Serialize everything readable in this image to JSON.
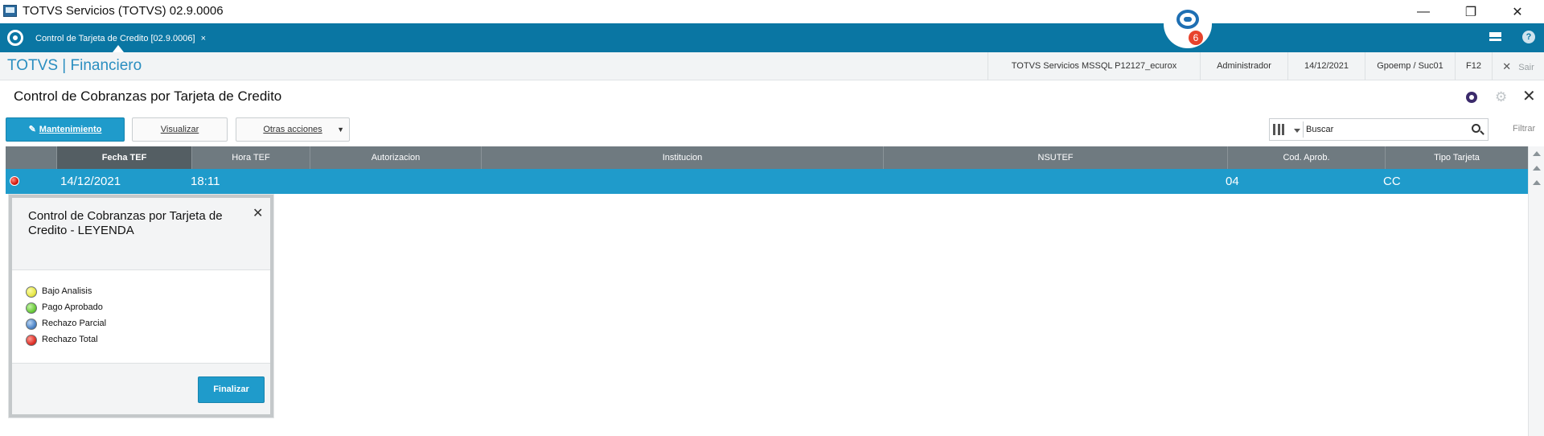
{
  "window": {
    "title": "TOTVS Servicios (TOTVS) 02.9.0006",
    "minimize": "—",
    "restore": "❐",
    "close": "✕"
  },
  "chat": {
    "badge": "6"
  },
  "tabs": [
    {
      "label": "Control de Tarjeta de Credito [02.9.0006]",
      "close": "×"
    }
  ],
  "module": {
    "brand": "TOTVS | Financiero",
    "environment": "TOTVS Servicios MSSQL P12127_ecurox",
    "user": "Administrador",
    "date": "14/12/2021",
    "branch": "Gpoemp / Suc01",
    "shortcut": "F12",
    "exit_icon": "✕",
    "exit": "Sair"
  },
  "page": {
    "title": "Control de Cobranzas por Tarjeta de Credito",
    "close": "✕"
  },
  "toolbar": {
    "mantenimiento": "Mantenimiento",
    "mantenimiento_icon": "✎",
    "visualizar": "Visualizar",
    "otras_acciones": "Otras acciones",
    "otras_caret": "▼",
    "search_placeholder": "Buscar",
    "filtrar": "Filtrar"
  },
  "grid": {
    "columns": [
      "Fecha TEF",
      "Hora TEF",
      "Autorizacion",
      "Institucion",
      "NSUTEF",
      "Cod. Aprob.",
      "Tipo Tarjeta"
    ],
    "rows": [
      {
        "status": "Rechazo Total",
        "fecha": "14/12/2021",
        "hora": "18:11",
        "autorizacion": "",
        "institucion": "",
        "nsutef": "",
        "cod_aprob": "04",
        "tipo": "CC"
      }
    ]
  },
  "legend": {
    "title": "Control de Cobranzas por Tarjeta de Credito - LEYENDA",
    "close": "✕",
    "items": [
      {
        "label": "Bajo Analisis",
        "color": "#e8e84a"
      },
      {
        "label": "Pago Aprobado",
        "color": "#6ccd3c"
      },
      {
        "label": "Rechazo Parcial",
        "color": "#4f86c8"
      },
      {
        "label": "Rechazo Total",
        "color": "#e0322a"
      }
    ],
    "button": "Finalizar"
  },
  "colors": {
    "accent": "#1f9bcb",
    "tabbar": "#0a76a3",
    "brand": "#2a8ec0",
    "grid_header": "#6f7a80"
  }
}
